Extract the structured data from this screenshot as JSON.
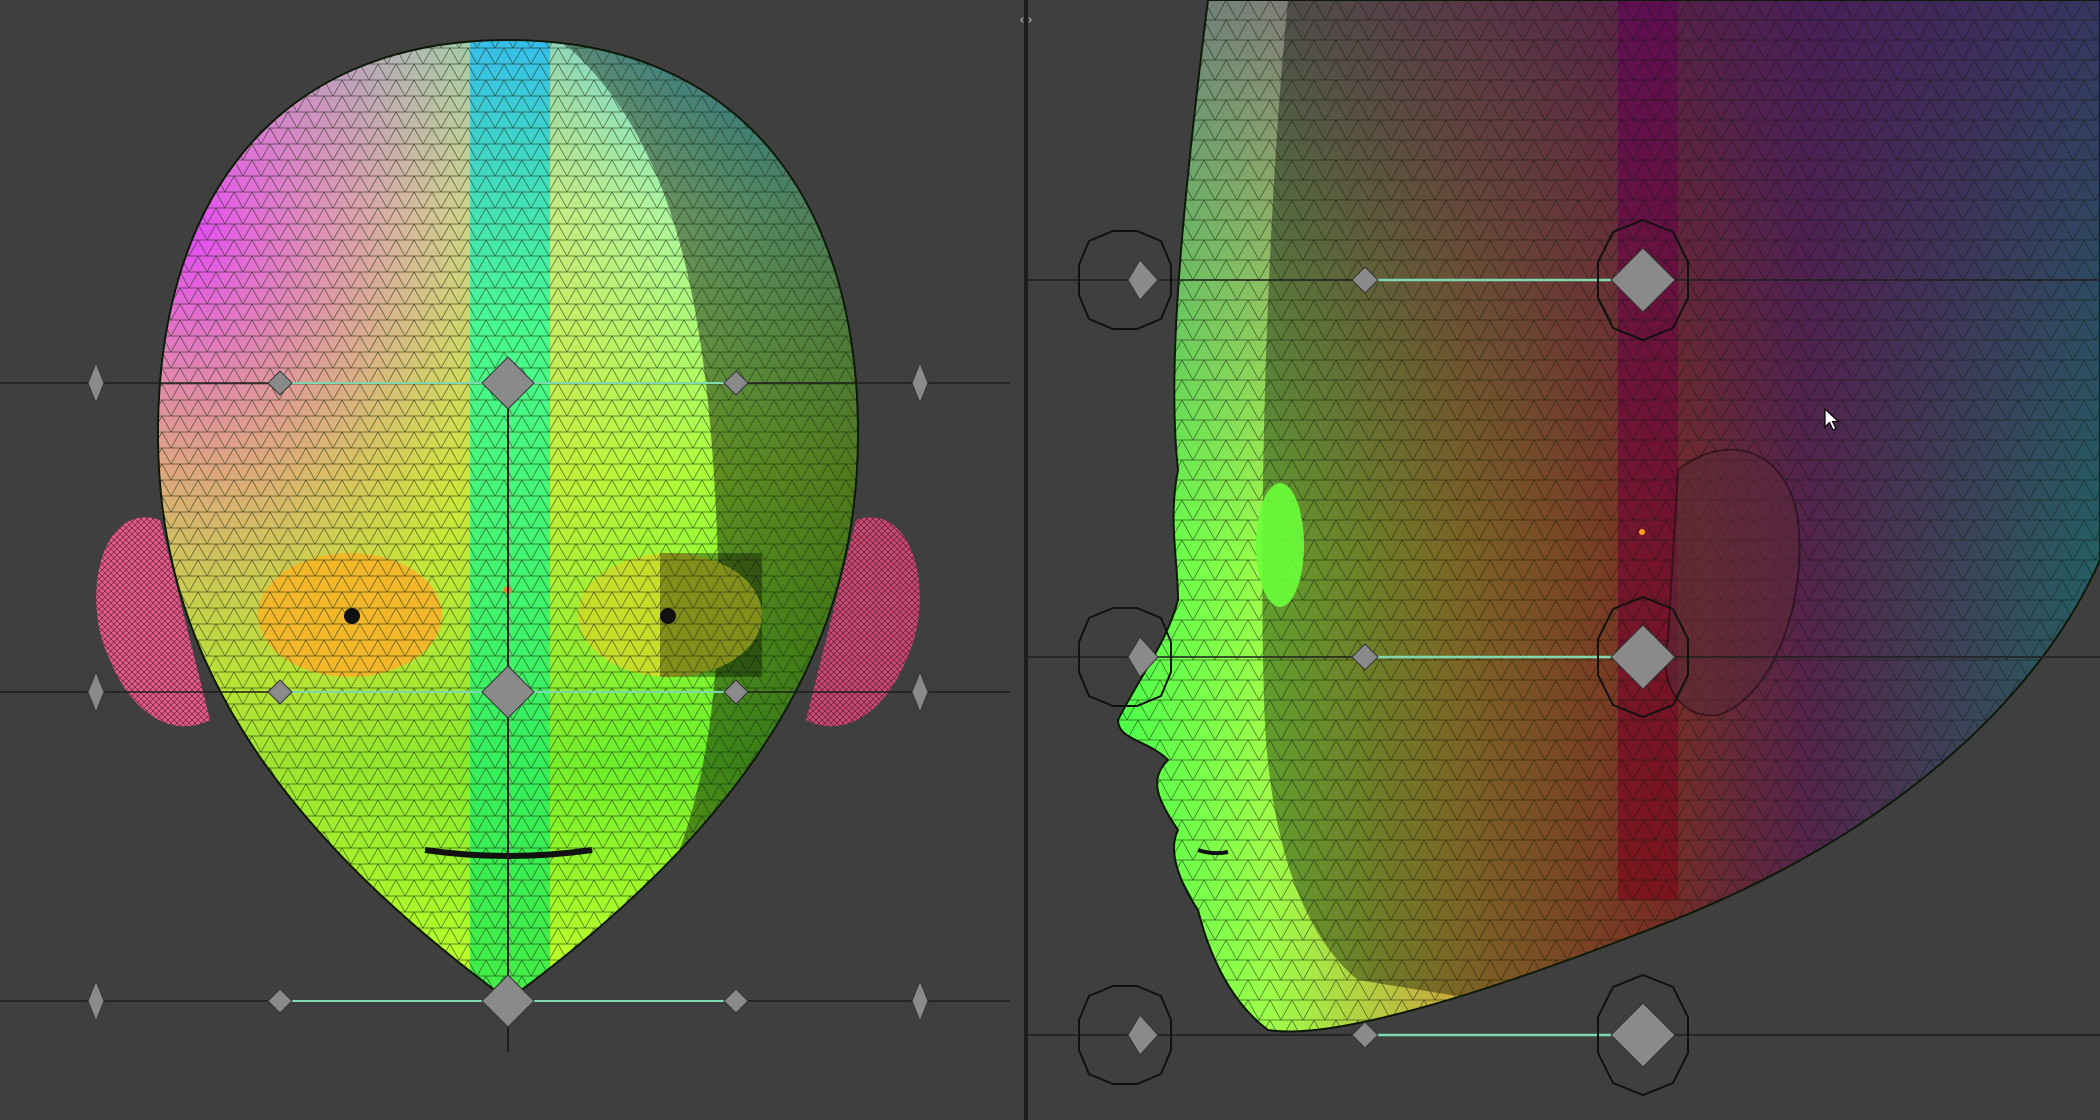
{
  "window": {
    "split_handle_glyph": "‹›"
  },
  "icons": {
    "split_handle": "split-handle-icon",
    "cursor": "mouse-cursor-icon",
    "control_point": "diamond-handle-icon"
  },
  "colors": {
    "background": "#3f3f3f",
    "divider": "#1c1c1c",
    "handle_fill": "#8a8a8a",
    "guide_line_active": "#7fd8b0",
    "guide_line": "#1e1e1e"
  }
}
